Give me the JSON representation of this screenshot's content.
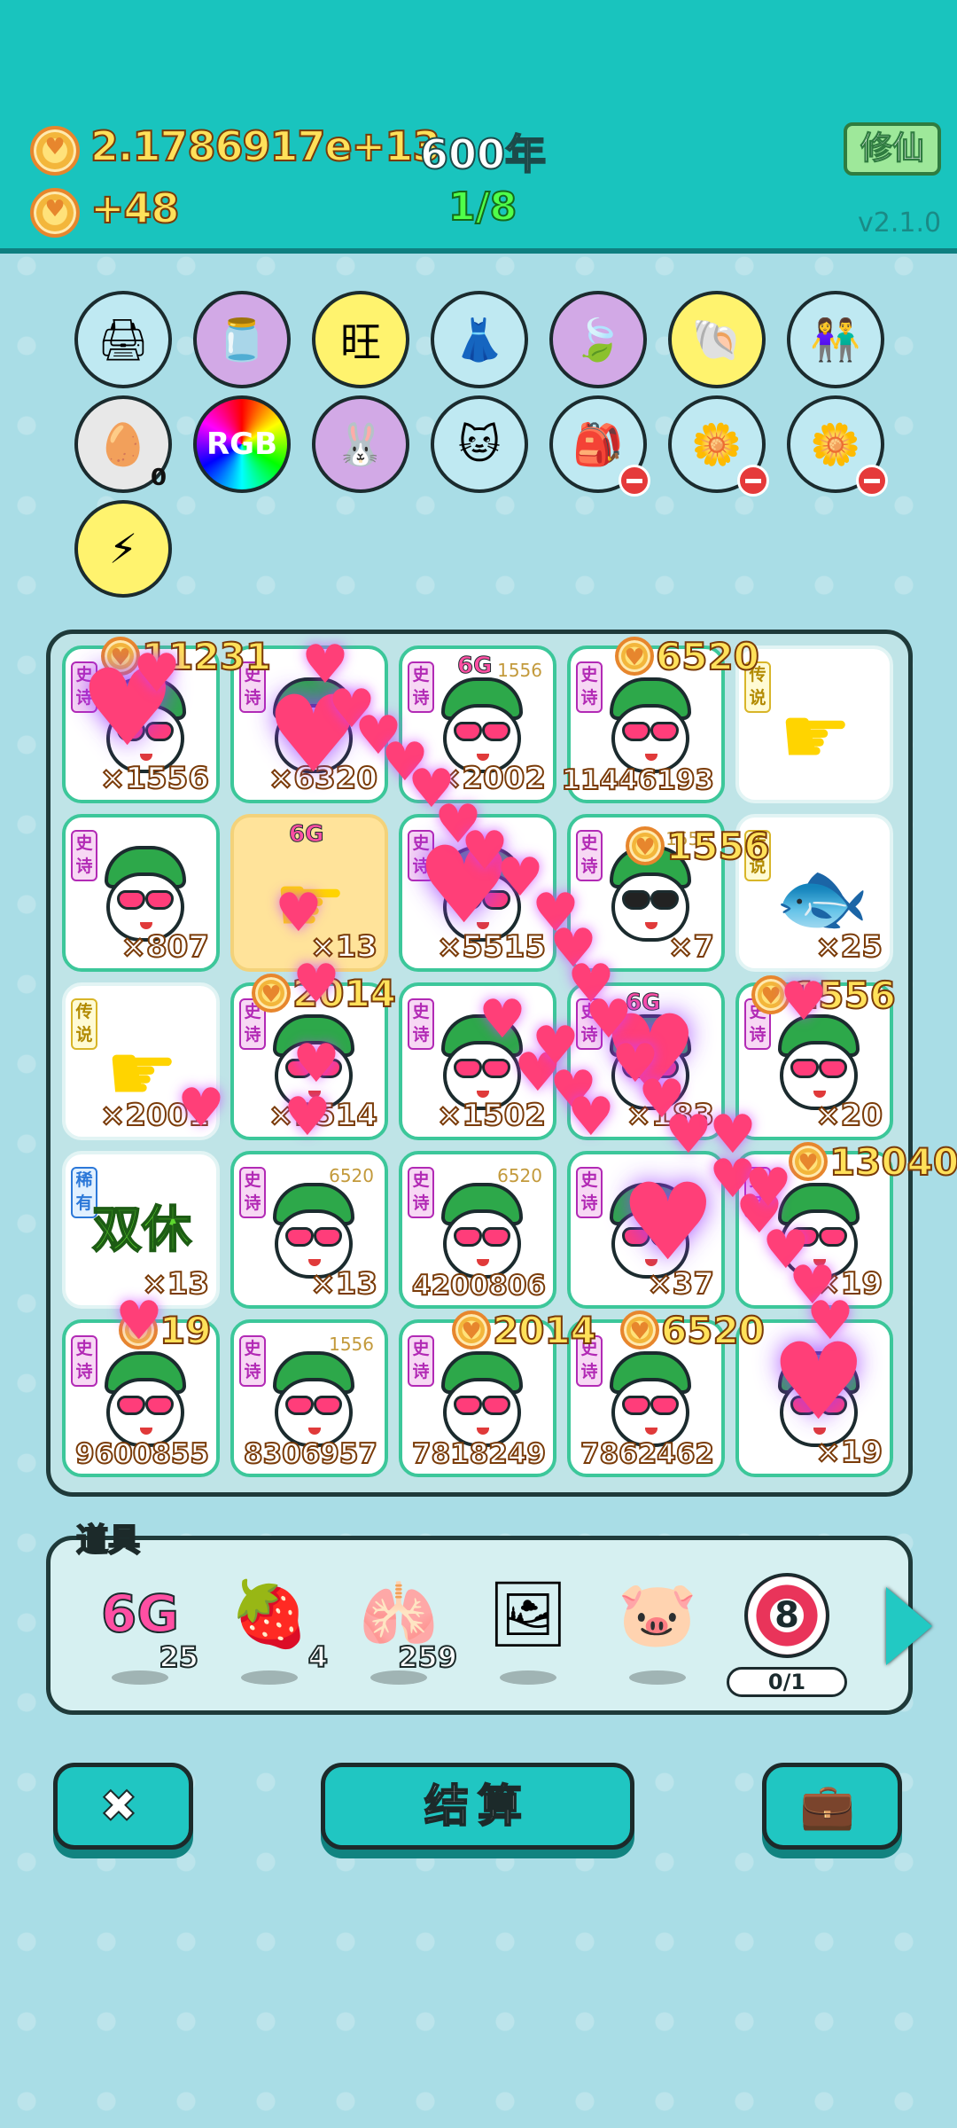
{
  "header": {
    "coins": "2.1786917e+13",
    "years": "600年",
    "income": "+48",
    "stage": "1/8",
    "xiuxian_label": "修仙",
    "version": "v2.1.0"
  },
  "upgrades": [
    {
      "name": "printer-icon",
      "glyph": "🖨",
      "bg": "#bfe9f2"
    },
    {
      "name": "cream-jar-icon",
      "glyph": "🫙",
      "bg": "#d2a9e6"
    },
    {
      "name": "wang-icon",
      "glyph": "旺",
      "bg": "#fff36e"
    },
    {
      "name": "skirt-icon",
      "glyph": "👗",
      "bg": "#bfe9f2"
    },
    {
      "name": "leaf-icon",
      "glyph": "🍃",
      "bg": "#d2a9e6"
    },
    {
      "name": "shell-icon",
      "glyph": "🐚",
      "bg": "#fff36e"
    },
    {
      "name": "couple-icon",
      "glyph": "👫",
      "bg": "#bfe9f2"
    },
    {
      "name": "egg-tray-icon",
      "glyph": "🥚",
      "bg": "#e8e8e8"
    },
    {
      "name": "rgb-icon",
      "glyph": "RGB",
      "bg": "#333"
    },
    {
      "name": "rabbit-icon",
      "glyph": "🐰",
      "bg": "#d2a9e6"
    },
    {
      "name": "cat-icon",
      "glyph": "🐱",
      "bg": "#bfe9f2"
    },
    {
      "name": "bag-icon",
      "glyph": "🎒",
      "bg": "#bfe9f2"
    },
    {
      "name": "flower-pot-icon",
      "glyph": "🌼",
      "bg": "#bfe9f2"
    },
    {
      "name": "flower-pot-2-icon",
      "glyph": "🌼",
      "bg": "#bfe9f2"
    },
    {
      "name": "lightning-icon",
      "glyph": "⚡",
      "bg": "#fff36e"
    }
  ],
  "upgrade_egg_count": "0",
  "tags": {
    "epic": "史诗",
    "legend": "传说",
    "rare": "稀有"
  },
  "grid": [
    {
      "kind": "face",
      "tag": "epic",
      "count": "×1556"
    },
    {
      "kind": "face",
      "tag": "epic",
      "count": "×6320"
    },
    {
      "kind": "face",
      "tag": "epic",
      "count": "×2002",
      "sixg": "6G",
      "mini": "1556"
    },
    {
      "kind": "face",
      "tag": "epic",
      "count": "11446193"
    },
    {
      "kind": "hand",
      "tag": "legend",
      "count": ""
    },
    {
      "kind": "face",
      "tag": "epic",
      "count": "×807"
    },
    {
      "kind": "hand-gold",
      "tag": "",
      "count": "×13",
      "sixg": "6G"
    },
    {
      "kind": "face",
      "tag": "epic",
      "count": "×5515"
    },
    {
      "kind": "face-dark",
      "tag": "epic",
      "count": "×7",
      "mini": "1556"
    },
    {
      "kind": "fish",
      "tag": "legend",
      "count": "×25"
    },
    {
      "kind": "hand",
      "tag": "legend",
      "count": "×2001"
    },
    {
      "kind": "face",
      "tag": "epic",
      "count": "×1514"
    },
    {
      "kind": "face",
      "tag": "epic",
      "count": "×1502"
    },
    {
      "kind": "face",
      "tag": "epic",
      "count": "×183",
      "sixg": "6G"
    },
    {
      "kind": "face",
      "tag": "epic",
      "count": "×20"
    },
    {
      "kind": "double",
      "tag": "rare",
      "count": "×13",
      "text": "双休"
    },
    {
      "kind": "face",
      "tag": "epic",
      "count": "×13",
      "mini": "6520"
    },
    {
      "kind": "face",
      "tag": "epic",
      "count": "4200806",
      "mini": "6520"
    },
    {
      "kind": "face",
      "tag": "epic",
      "count": "×37"
    },
    {
      "kind": "face",
      "tag": "epic",
      "count": "×19"
    },
    {
      "kind": "face",
      "tag": "epic",
      "count": "9600855"
    },
    {
      "kind": "face",
      "tag": "epic",
      "count": "8306957",
      "mini": "1556"
    },
    {
      "kind": "face",
      "tag": "epic",
      "count": "7818249"
    },
    {
      "kind": "face",
      "tag": "epic",
      "count": "7862462"
    },
    {
      "kind": "face",
      "tag": "",
      "count": "×19"
    }
  ],
  "floating": [
    "11231",
    "6520",
    "1556",
    "2014",
    "1556",
    "13040",
    "19",
    "2014",
    "6520"
  ],
  "items_label": "道具",
  "items": [
    {
      "name": "6g-item",
      "label": "6G",
      "qty": "25"
    },
    {
      "name": "bayberry-item",
      "glyph": "🍓",
      "qty": "4"
    },
    {
      "name": "liver-item",
      "glyph": "🫁",
      "qty": "259"
    },
    {
      "name": "portrait-item",
      "glyph": "🖼",
      "qty": ""
    },
    {
      "name": "piggy-bank-item",
      "glyph": "🐷",
      "qty": ""
    },
    {
      "name": "target-item",
      "label": "8",
      "qty": "0/1"
    }
  ],
  "buttons": {
    "close": "✖",
    "settle": "结算",
    "bag": "💼"
  }
}
